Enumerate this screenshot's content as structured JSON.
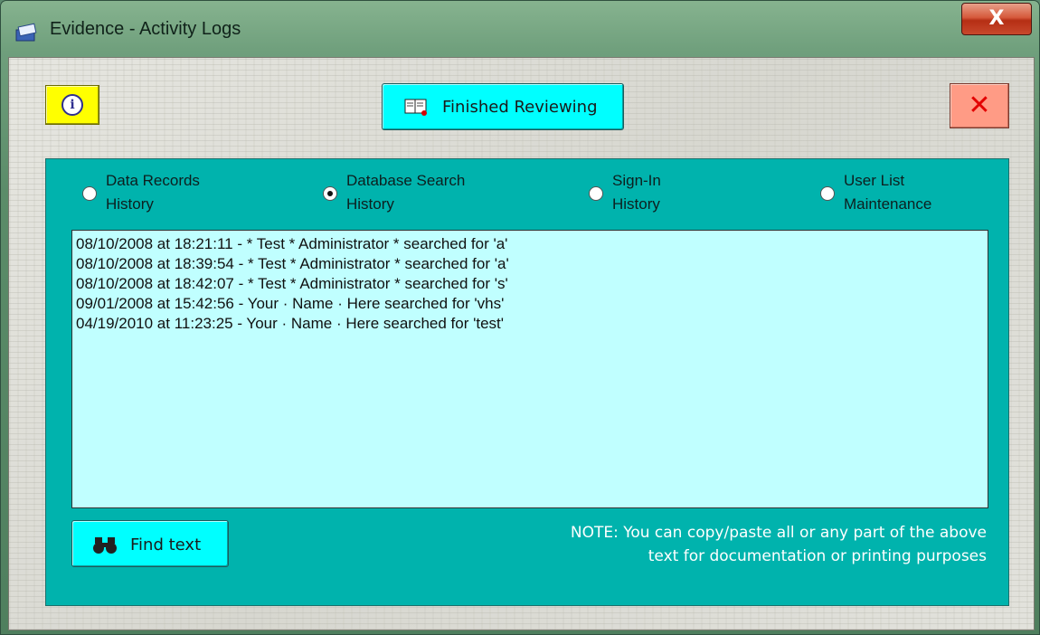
{
  "window": {
    "title": "Evidence - Activity Logs",
    "close_label": "X"
  },
  "toolbar": {
    "info_icon": "info-speech-icon",
    "info_glyph": "i",
    "finished_label": "Finished Reviewing",
    "finished_icon": "book-review-icon",
    "exit_label": "✕",
    "exit_icon": "close-x-icon"
  },
  "tabs": [
    {
      "line1": "Data Records",
      "line2": "History",
      "selected": false
    },
    {
      "line1": "Database Search",
      "line2": "History",
      "selected": true
    },
    {
      "line1": "Sign-In",
      "line2": "History",
      "selected": false
    },
    {
      "line1": "User List",
      "line2": "Maintenance",
      "selected": false
    }
  ],
  "log_lines": [
    "08/10/2008 at 18:21:11 - * Test * Administrator * searched for 'a'",
    "08/10/2008 at 18:39:54 - * Test * Administrator * searched for 'a'",
    "08/10/2008 at 18:42:07 - * Test * Administrator * searched for 's'",
    "09/01/2008 at 15:42:56 - Your · Name · Here searched for 'vhs'",
    "04/19/2010 at 11:23:25 - Your · Name · Here searched for 'test'"
  ],
  "find": {
    "label": "Find text",
    "icon": "binoculars-icon"
  },
  "note": {
    "line1": "NOTE: You can copy/paste all or any part of the above",
    "line2": "text for documentation or printing purposes"
  },
  "colors": {
    "panel": "#00b3ad",
    "log_bg": "#c0ffff",
    "button_cyan": "#00ffff",
    "info_yellow": "#ffff00",
    "exit_pink": "#ff9b85"
  }
}
